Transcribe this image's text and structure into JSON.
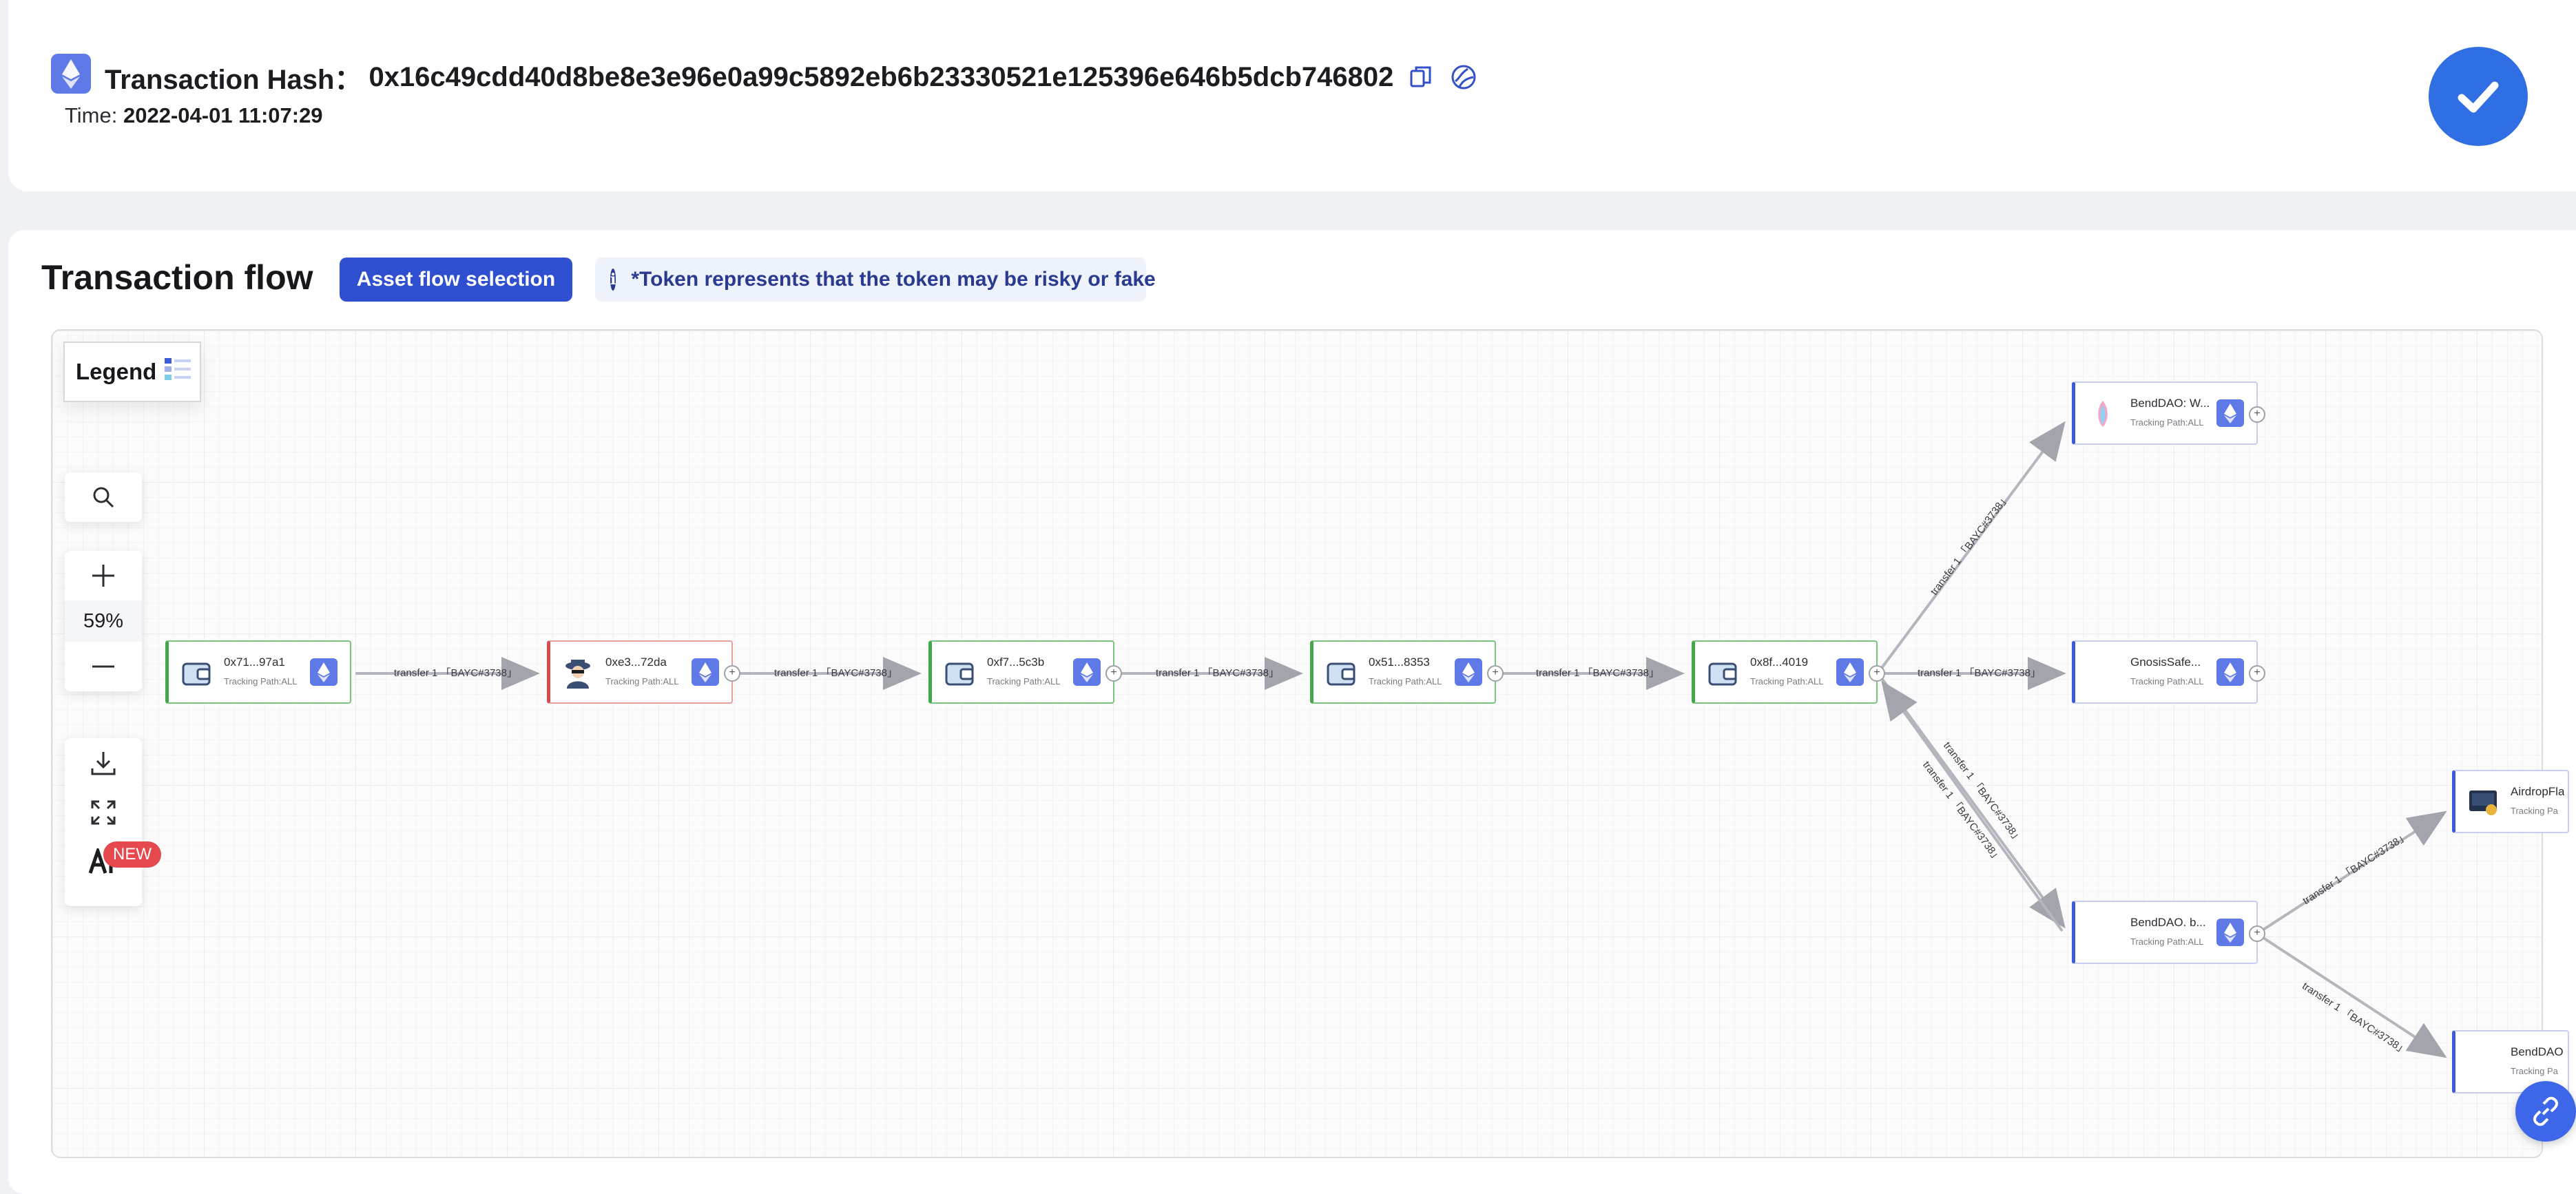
{
  "header": {
    "hash_label": "Transaction Hash：",
    "hash_value": "0x16c49cdd40d8be8e3e96e0a99c5892eb6b23330521e125396e646b5dcb746802",
    "time_label": "Time:",
    "time_value": "2022-04-01 11:07:29",
    "copy_icon": "copy-icon",
    "explorer_icon": "explorer-icon",
    "status_icon": "check-icon"
  },
  "flow": {
    "title": "Transaction flow",
    "asset_button": "Asset flow selection",
    "notice": "*Token represents that the token may be risky or fake",
    "legend_label": "Legend",
    "zoom": "59%",
    "new_badge": "NEW",
    "tools": [
      "search-icon",
      "zoom-in-icon",
      "zoom-out-icon",
      "download-icon",
      "fullscreen-icon",
      "ai-icon"
    ]
  },
  "nodes": [
    {
      "name": "0x71...97a1",
      "path": "Tracking Path:ALL",
      "kind": "wallet"
    },
    {
      "name": "0xe3...72da",
      "path": "Tracking Path:ALL",
      "kind": "hacker"
    },
    {
      "name": "0xf7...5c3b",
      "path": "Tracking Path:ALL",
      "kind": "wallet"
    },
    {
      "name": "0x51...8353",
      "path": "Tracking Path:ALL",
      "kind": "wallet"
    },
    {
      "name": "0x8f...4019",
      "path": "Tracking Path:ALL",
      "kind": "wallet"
    },
    {
      "name": "BendDAO: W...",
      "path": "Tracking Path:ALL",
      "kind": "contract"
    },
    {
      "name": "GnosisSafe...",
      "path": "Tracking Path:ALL",
      "kind": "contract"
    },
    {
      "name": "BendDAO. b...",
      "path": "Tracking Path:ALL",
      "kind": "contract"
    },
    {
      "name": "AirdropFla",
      "path": "Tracking Pa",
      "kind": "contract"
    },
    {
      "name": "BendDAO",
      "path": "Tracking Pa",
      "kind": "contract"
    }
  ],
  "edge_label": "transfer 1 「BAYC#3738」",
  "colors": {
    "brand": "#2f4fd1",
    "eth": "#5f7ae6",
    "success": "#2f6fe3",
    "green_node": "#44a84b",
    "red_node": "#d94a4a",
    "blue_node": "#3b5bdb"
  }
}
